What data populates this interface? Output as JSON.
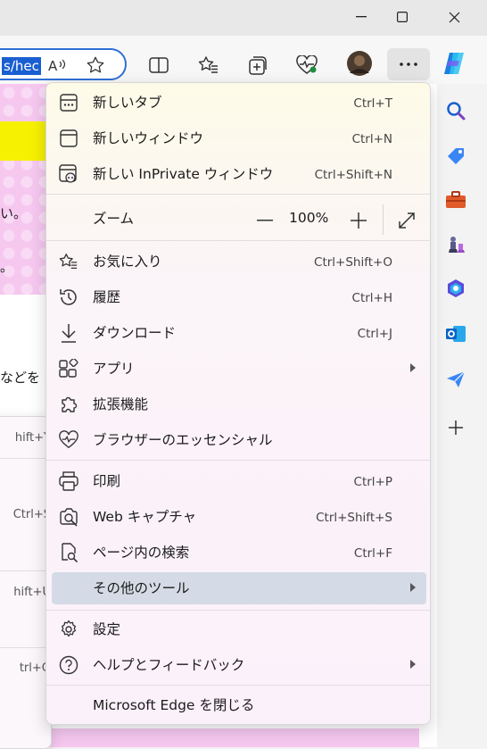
{
  "toolbar": {
    "url_fragment": "s/hec"
  },
  "page_peek": {
    "line1": "い。",
    "line2": "。",
    "line3": "などを"
  },
  "submenu_peek": {
    "items": [
      "hift+Y",
      "Ctrl+S",
      "hift+U",
      "trl+Q"
    ]
  },
  "menu": {
    "items": [
      {
        "label": "新しいタブ",
        "shortcut": "Ctrl+T",
        "icon": "new-tab-icon"
      },
      {
        "label": "新しいウィンドウ",
        "shortcut": "Ctrl+N",
        "icon": "new-window-icon"
      },
      {
        "label": "新しい InPrivate ウィンドウ",
        "shortcut": "Ctrl+Shift+N",
        "icon": "inprivate-window-icon"
      },
      {
        "label": "お気に入り",
        "shortcut": "Ctrl+Shift+O",
        "icon": "favorites-star-icon"
      },
      {
        "label": "履歴",
        "shortcut": "Ctrl+H",
        "icon": "history-icon"
      },
      {
        "label": "ダウンロード",
        "shortcut": "Ctrl+J",
        "icon": "download-icon"
      },
      {
        "label": "アプリ",
        "shortcut": "",
        "icon": "apps-icon",
        "submenu": true
      },
      {
        "label": "拡張機能",
        "shortcut": "",
        "icon": "extensions-puzzle-icon"
      },
      {
        "label": "ブラウザーのエッセンシャル",
        "shortcut": "",
        "icon": "browser-essentials-heart-icon"
      },
      {
        "label": "印刷",
        "shortcut": "Ctrl+P",
        "icon": "print-icon"
      },
      {
        "label": "Web キャプチャ",
        "shortcut": "Ctrl+Shift+S",
        "icon": "web-capture-icon"
      },
      {
        "label": "ページ内の検索",
        "shortcut": "Ctrl+F",
        "icon": "find-on-page-icon"
      },
      {
        "label": "その他のツール",
        "shortcut": "",
        "icon": "",
        "submenu": true,
        "selected": true
      },
      {
        "label": "設定",
        "shortcut": "",
        "icon": "settings-gear-icon"
      },
      {
        "label": "ヘルプとフィードバック",
        "shortcut": "",
        "icon": "help-icon",
        "submenu": true
      },
      {
        "label": "Microsoft Edge を閉じる",
        "shortcut": "",
        "icon": ""
      }
    ],
    "zoom": {
      "label": "ズーム",
      "value": "100%"
    }
  },
  "colors": {
    "address_highlight": "#1a5fd1",
    "address_border": "#2f6fd6",
    "selected_item": "#d5dbe6"
  }
}
